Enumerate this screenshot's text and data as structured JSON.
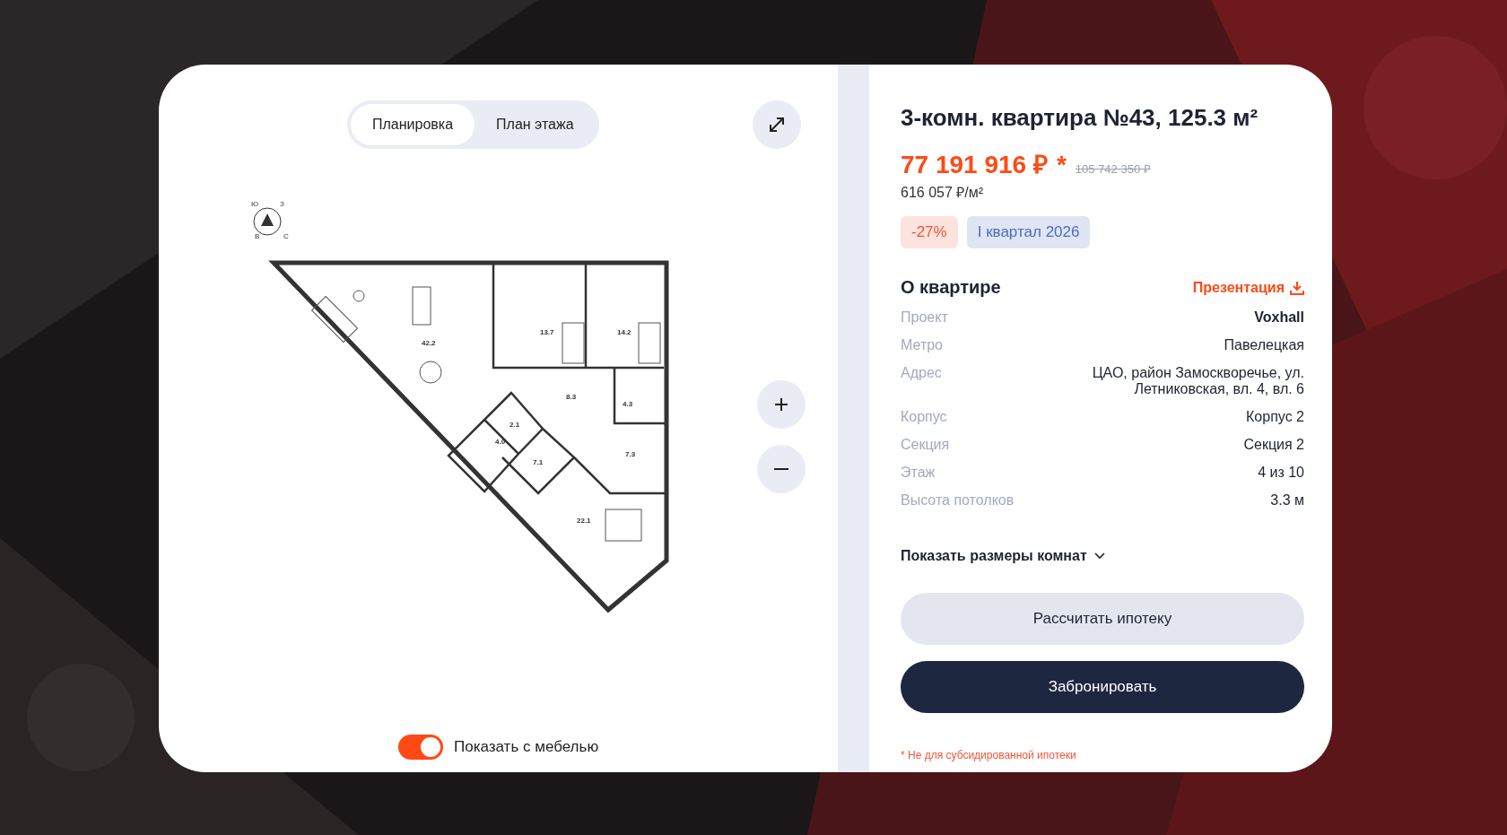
{
  "view_tabs": [
    {
      "label": "Планировка",
      "selected": true
    },
    {
      "label": "План этажа",
      "selected": false
    }
  ],
  "plan": {
    "compass": [
      "Ю",
      "З",
      "В",
      "С"
    ],
    "rooms": [
      {
        "area": "42.2"
      },
      {
        "area": "13.7"
      },
      {
        "area": "14.2"
      },
      {
        "area": "8.3"
      },
      {
        "area": "4.3"
      },
      {
        "area": "2.1"
      },
      {
        "area": "4.0"
      },
      {
        "area": "7.1"
      },
      {
        "area": "7.3"
      },
      {
        "area": "22.1"
      }
    ]
  },
  "furniture_toggle": {
    "label": "Показать с мебелью",
    "on": true
  },
  "title": "3-комн. квартира №43, 125.3 м²",
  "price": {
    "current": "77 191 916 ₽",
    "mark": "*",
    "old": "105 742 350 ₽",
    "per_m2": "616 057 ₽/м²"
  },
  "badges": [
    {
      "text": "-27%",
      "kind": "discount"
    },
    {
      "text": "I квартал 2026",
      "kind": "date"
    }
  ],
  "about": {
    "heading": "О квартире",
    "link": "Презентация",
    "rows": [
      {
        "label": "Проект",
        "value": "Voxhall",
        "kind": "bold"
      },
      {
        "label": "Метро",
        "value": "Павелецкая",
        "kind": "plain"
      },
      {
        "label": "Адрес",
        "value": "ЦАО, район Замоскворечье, ул. Летниковская, вл. 4, вл. 6",
        "kind": "plain"
      },
      {
        "label": "Корпус",
        "value": "Корпус 2",
        "kind": "plain"
      },
      {
        "label": "Секция",
        "value": "Секция 2",
        "kind": "plain"
      },
      {
        "label": "Этаж",
        "value": "4 из 10",
        "kind": "plain"
      },
      {
        "label": "Высота потолков",
        "value": "3.3 м",
        "kind": "plain"
      }
    ]
  },
  "room_sizes": {
    "label": "Показать размеры комнат",
    "expanded": false
  },
  "buttons": [
    {
      "label": "Рассчитать ипотеку",
      "kind": "secondary"
    },
    {
      "label": "Забронировать",
      "kind": "primary"
    }
  ],
  "footnote": "* Не для субсидированной ипотеки"
}
